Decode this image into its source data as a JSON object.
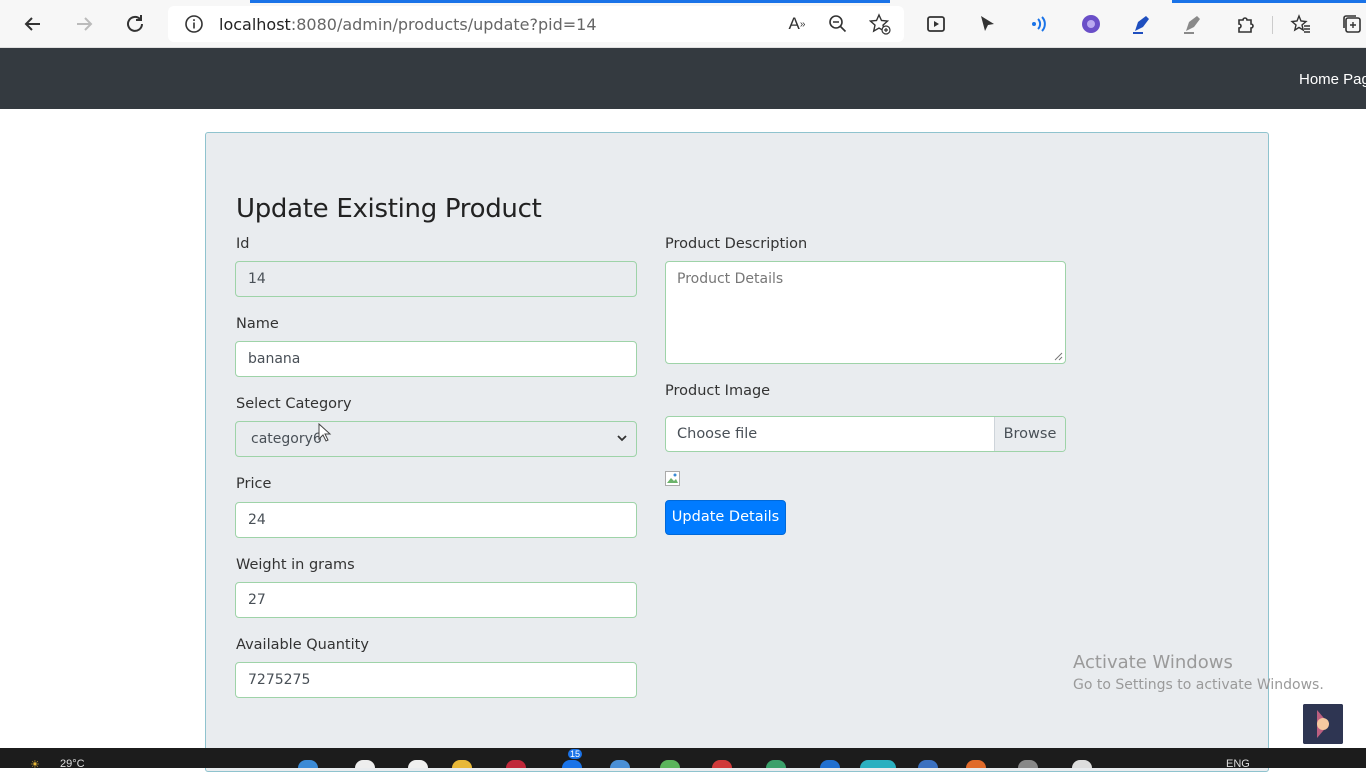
{
  "browser": {
    "url_host": "localhost",
    "url_rest": ":8080/admin/products/update?pid=14",
    "icons": [
      "back-icon",
      "forward-icon",
      "refresh-icon",
      "info-icon",
      "read-aloud-icon",
      "zoom-out-icon",
      "favorite-add-icon",
      "app-icon",
      "play-icon",
      "wifi-icon",
      "extension-purple-icon",
      "pen-icon",
      "pen-disabled-icon",
      "extensions-icon",
      "favorites-icon",
      "collections-icon"
    ]
  },
  "appnav": {
    "home_link": "Home Pag"
  },
  "form": {
    "title": "Update Existing Product",
    "id_label": "Id",
    "id_value": "14",
    "name_label": "Name",
    "name_value": "banana",
    "category_label": "Select Category",
    "category_value": "category6",
    "price_label": "Price",
    "price_value": "24",
    "weight_label": "Weight in grams",
    "weight_value": "27",
    "quantity_label": "Available Quantity",
    "quantity_value": "7275275",
    "description_label": "Product Description",
    "description_placeholder": "Product Details",
    "image_label": "Product Image",
    "file_placeholder": "Choose file",
    "browse_label": "Browse",
    "submit_label": "Update Details"
  },
  "watermark": {
    "title": "Activate Windows",
    "subtitle": "Go to Settings to activate Windows."
  },
  "taskbar": {
    "weather": "29°C",
    "lang": "ENG",
    "badge": "15"
  },
  "colors": {
    "navbar": "#343a40",
    "jumbotron": "#e9ecef",
    "primary": "#007bff",
    "input_border": "#9ed3a8"
  }
}
